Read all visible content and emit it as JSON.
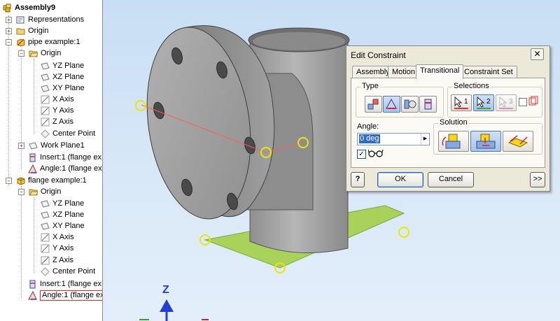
{
  "tree": {
    "root": "Assembly9",
    "items": [
      {
        "label": "Representations",
        "icon": "representations-icon"
      },
      {
        "label": "Origin",
        "icon": "folder-icon"
      },
      {
        "label": "pipe example:1",
        "icon": "part-icon"
      },
      {
        "label": "Origin",
        "icon": "folder-icon"
      },
      {
        "label": "YZ Plane",
        "icon": "plane-icon"
      },
      {
        "label": "XZ Plane",
        "icon": "plane-icon"
      },
      {
        "label": "XY Plane",
        "icon": "plane-icon"
      },
      {
        "label": "X Axis",
        "icon": "axis-icon"
      },
      {
        "label": "Y Axis",
        "icon": "axis-icon"
      },
      {
        "label": "Z Axis",
        "icon": "axis-icon"
      },
      {
        "label": "Center Point",
        "icon": "point-icon"
      },
      {
        "label": "Work Plane1",
        "icon": "plane-icon"
      },
      {
        "label": "Insert:1 (flange ex",
        "icon": "insert-constraint-icon"
      },
      {
        "label": "Angle:1 (flange ex",
        "icon": "angle-constraint-icon"
      },
      {
        "label": "flange example:1",
        "icon": "part-icon"
      },
      {
        "label": "Origin",
        "icon": "folder-icon"
      },
      {
        "label": "YZ Plane",
        "icon": "plane-icon"
      },
      {
        "label": "XZ Plane",
        "icon": "plane-icon"
      },
      {
        "label": "XY Plane",
        "icon": "plane-icon"
      },
      {
        "label": "X Axis",
        "icon": "axis-icon"
      },
      {
        "label": "Y Axis",
        "icon": "axis-icon"
      },
      {
        "label": "Z Axis",
        "icon": "axis-icon"
      },
      {
        "label": "Center Point",
        "icon": "point-icon"
      },
      {
        "label": "Insert:1 (flange ex",
        "icon": "insert-constraint-icon"
      },
      {
        "label": "Angle:1 (flange ex",
        "icon": "angle-constraint-icon"
      }
    ]
  },
  "viewport": {
    "triad_label": "Z",
    "axis_colors": {
      "z": "#1f3fd8",
      "x": "#d42020",
      "y": "#20b020"
    },
    "selection_color": "#e8e800",
    "angle_line_color": "#ff5a5a",
    "plane_color": "#a8d25a"
  },
  "dialog": {
    "title": "Edit Constraint",
    "close_glyph": "✕",
    "tabs": [
      "Assembly",
      "Motion",
      "Transitional",
      "Constraint Set"
    ],
    "active_tab": "Transitional",
    "type_label": "Type",
    "selections_label": "Selections",
    "selection_numbers": [
      "1",
      "2",
      "3"
    ],
    "angle_label": "Angle:",
    "angle_value": "0 deg",
    "solution_label": "Solution",
    "ok_label": "OK",
    "cancel_label": "Cancel",
    "help_glyph": "?",
    "more_glyph": ">>",
    "preview_checked": true
  }
}
